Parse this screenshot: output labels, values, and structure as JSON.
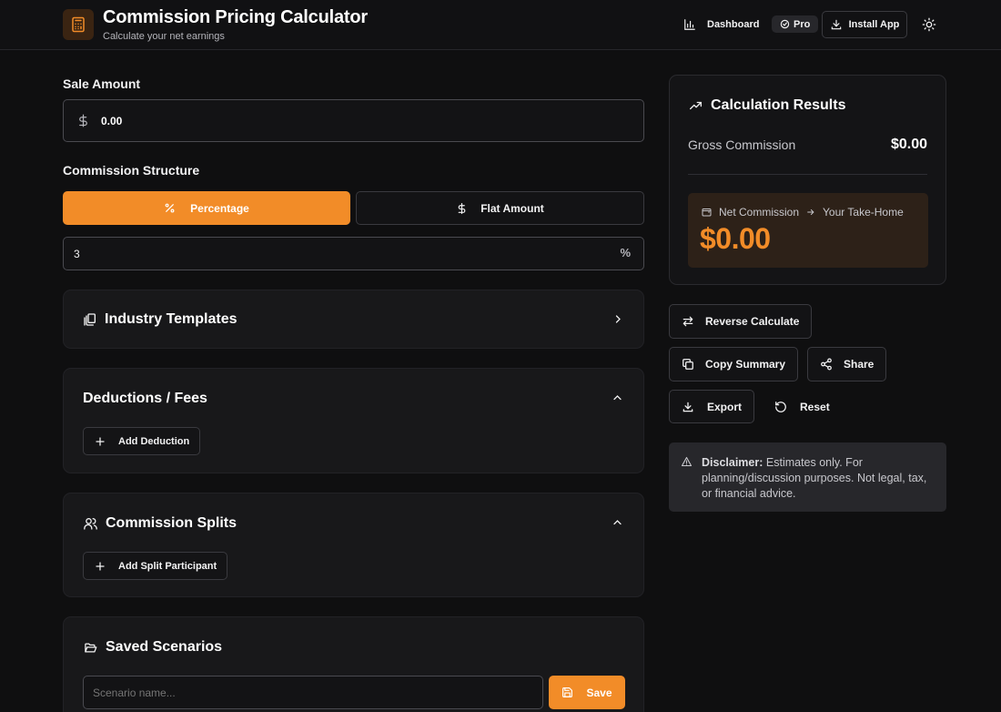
{
  "header": {
    "title": "Commission Pricing Calculator",
    "subtitle": "Calculate your net earnings",
    "dashboard_label": "Dashboard",
    "pro_label": "Pro",
    "install_label": "Install App",
    "brand_color": "#f28c28"
  },
  "form": {
    "sale_amount_label": "Sale Amount",
    "sale_amount_value": "0.00",
    "structure_label": "Commission Structure",
    "percentage_label": "Percentage",
    "flat_label": "Flat Amount",
    "rate_value": "3",
    "rate_unit": "%"
  },
  "sections": {
    "templates_title": "Industry Templates",
    "deductions_title": "Deductions / Fees",
    "add_deduction_label": "Add Deduction",
    "splits_title": "Commission Splits",
    "add_split_label": "Add Split Participant",
    "scenarios_title": "Saved Scenarios",
    "scenario_placeholder": "Scenario name...",
    "save_label": "Save"
  },
  "results": {
    "title": "Calculation Results",
    "gross_label": "Gross Commission",
    "gross_value": "$0.00",
    "net_label": "Net Commission",
    "takehome_label": "Your Take-Home",
    "net_value": "$0.00"
  },
  "actions": {
    "reverse_label": "Reverse Calculate",
    "copy_label": "Copy Summary",
    "share_label": "Share",
    "export_label": "Export",
    "reset_label": "Reset"
  },
  "disclaimer": {
    "bold": "Disclaimer:",
    "text": " Estimates only. For planning/discussion purposes. Not legal, tax, or financial advice."
  }
}
